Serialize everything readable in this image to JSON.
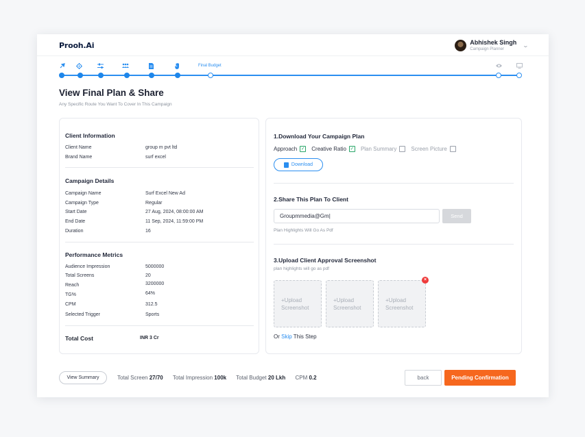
{
  "app": {
    "logo": "Prooh.Ai"
  },
  "user": {
    "name": "Abhishek Singh",
    "role": "Campaign Planner"
  },
  "stepper": {
    "current_label": "Final Budget",
    "icons": [
      "pin-icon",
      "target-icon",
      "sliders-icon",
      "audience-icon",
      "document-icon",
      "hand-icon",
      "eye-icon",
      "screen-icon"
    ]
  },
  "page": {
    "title": "View Final Plan & Share",
    "subtitle": "Any Specific Route You Want To Cover In This Campaign"
  },
  "client": {
    "section_title": "Client Information",
    "rows": [
      {
        "label": "Client Name",
        "value": "group m pvt ltd"
      },
      {
        "label": "Brand Name",
        "value": "surf excel"
      }
    ]
  },
  "campaign": {
    "section_title": "Campaign Details",
    "rows": [
      {
        "label": "Campaign Name",
        "value": "Surf Excel New Ad"
      },
      {
        "label": "Campaign Type",
        "value": "Regular"
      },
      {
        "label": "Start Date",
        "value": "27 Aug, 2024, 08:00:00 AM"
      },
      {
        "label": "End Date",
        "value": "11 Sep, 2024, 11:59:00 PM"
      },
      {
        "label": "Duration",
        "value": "16"
      }
    ]
  },
  "performance": {
    "section_title": "Performance Metrics",
    "rows": [
      {
        "label": "Audience Impression",
        "value": "5000000"
      },
      {
        "label": "Total Screens",
        "value": "20"
      },
      {
        "label": "Reach",
        "value": "3200000"
      },
      {
        "label": "TG%",
        "value": "64%"
      },
      {
        "label": "CPM",
        "value": "312.5"
      },
      {
        "label": "Selected Trigger",
        "value": "Sports"
      }
    ]
  },
  "total_cost": {
    "label": "Total Cost",
    "value": "INR 3 Cr"
  },
  "download": {
    "title": "1.Download Your Campaign Plan",
    "options": [
      {
        "label": "Approach",
        "checked": true
      },
      {
        "label": "Creative Ratio",
        "checked": true
      },
      {
        "label": "Plan Summary",
        "checked": false
      },
      {
        "label": "Screen Picture",
        "checked": false
      }
    ],
    "button_label": "Download"
  },
  "share": {
    "title": "2.Share This Plan To Client",
    "email_value": "Groupmmedia@Gm|",
    "send_label": "Send",
    "note": "Plan Highlights Will Go As Pdf"
  },
  "upload": {
    "title": "3.Upload Client Approval Screenshot",
    "subtitle": "plan highlights will go as pdf",
    "box_line1": "+Upload",
    "box_line2": "Screenshot",
    "skip_prefix": "Or ",
    "skip_link": "Skip",
    "skip_suffix": " This Step"
  },
  "footer": {
    "view_summary": "View Summary",
    "total_screen_label": "Total Screen",
    "total_screen_value": "27/70",
    "total_impression_label": "Total Impression",
    "total_impression_value": "100k",
    "total_budget_label": "Total Budget",
    "total_budget_value": "20 Lkh",
    "cpm_label": "CPM",
    "cpm_value": "0.2",
    "back_label": "back",
    "confirm_label": "Pending Confirmation"
  },
  "colors": {
    "accent": "#2a8ef0",
    "primary_action": "#f6671e",
    "check": "#27a567"
  }
}
